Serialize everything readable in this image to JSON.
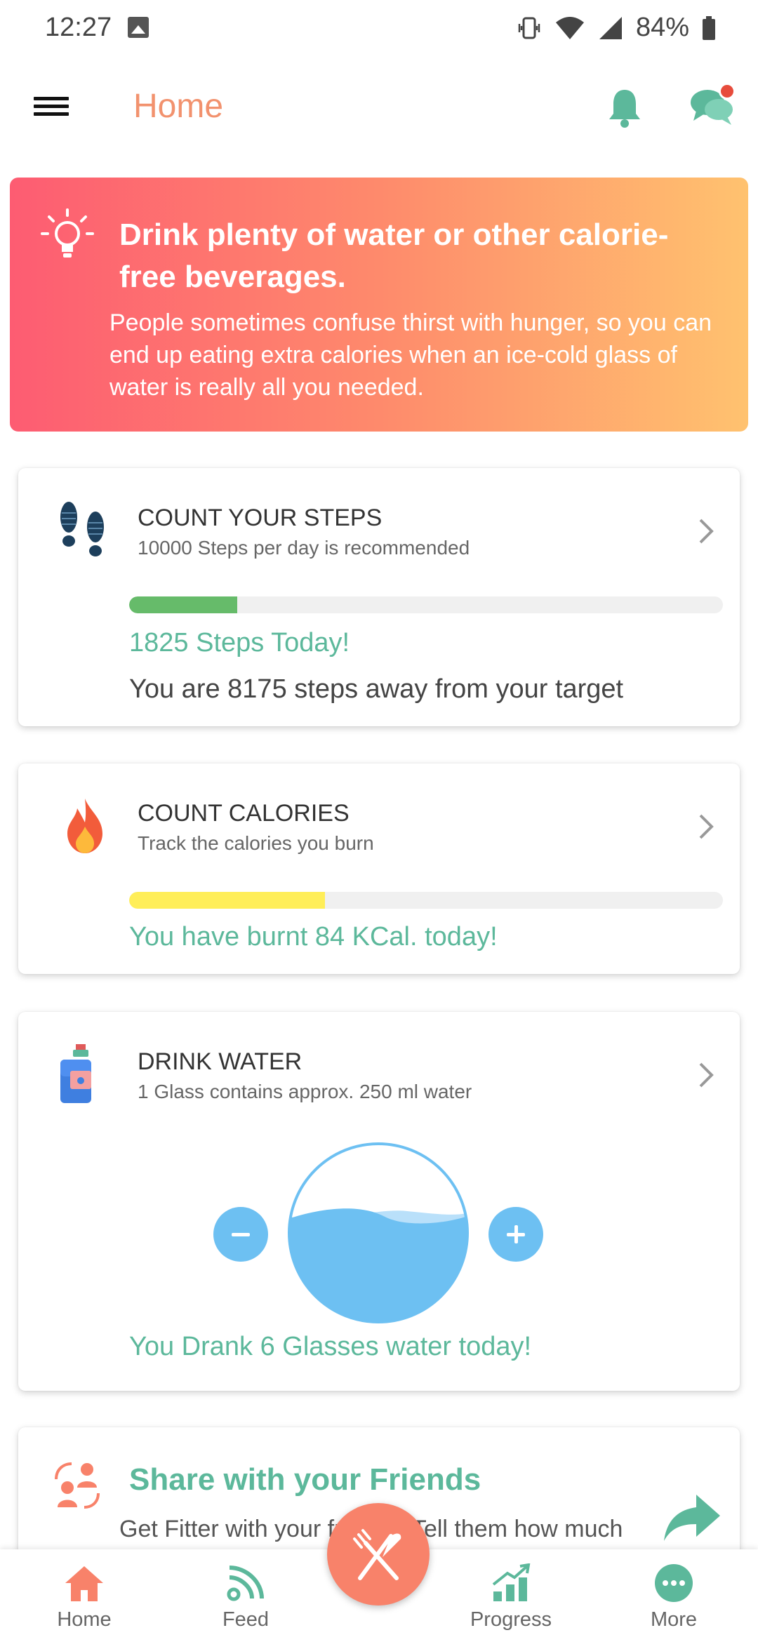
{
  "status_bar": {
    "time": "12:27",
    "battery": "84%"
  },
  "header": {
    "title": "Home"
  },
  "tip": {
    "title": "Drink plenty of water or other calorie-free beverages.",
    "body": "People sometimes confuse thirst with hunger, so you can end up eating extra calories when an ice-cold glass of water is really all you needed."
  },
  "steps": {
    "title": "COUNT YOUR STEPS",
    "subtitle": "10000 Steps per day is recommended",
    "today": "1825 Steps Today!",
    "remaining": "You are 8175 steps away from your target",
    "progress_fraction": 0.1825,
    "color": "#66bb6a"
  },
  "calories": {
    "title": "COUNT CALORIES",
    "subtitle": "Track the calories you burn",
    "burnt": "You have burnt 84 KCal. today!",
    "progress_fraction": 0.33,
    "color": "#ffee58"
  },
  "water": {
    "title": "DRINK WATER",
    "subtitle": "1 Glass contains approx. 250 ml water",
    "drank": "You Drank 6 Glasses water today!",
    "fill_fraction": 0.6,
    "color": "#6dc0f2"
  },
  "share": {
    "title": "Share with your Friends",
    "body": "Get Fitter with your friends. Tell them how much"
  },
  "bottom_nav": {
    "items": [
      {
        "label": "Home",
        "icon": "home-icon"
      },
      {
        "label": "Feed",
        "icon": "feed-icon"
      },
      {
        "label": "Progress",
        "icon": "progress-icon"
      },
      {
        "label": "More",
        "icon": "more-icon"
      }
    ],
    "fab_icon": "fork-knife-icon"
  },
  "colors": {
    "accent": "#f2926e",
    "teal": "#5cb89b",
    "water": "#6dc0f2",
    "fab": "#f8826a"
  }
}
